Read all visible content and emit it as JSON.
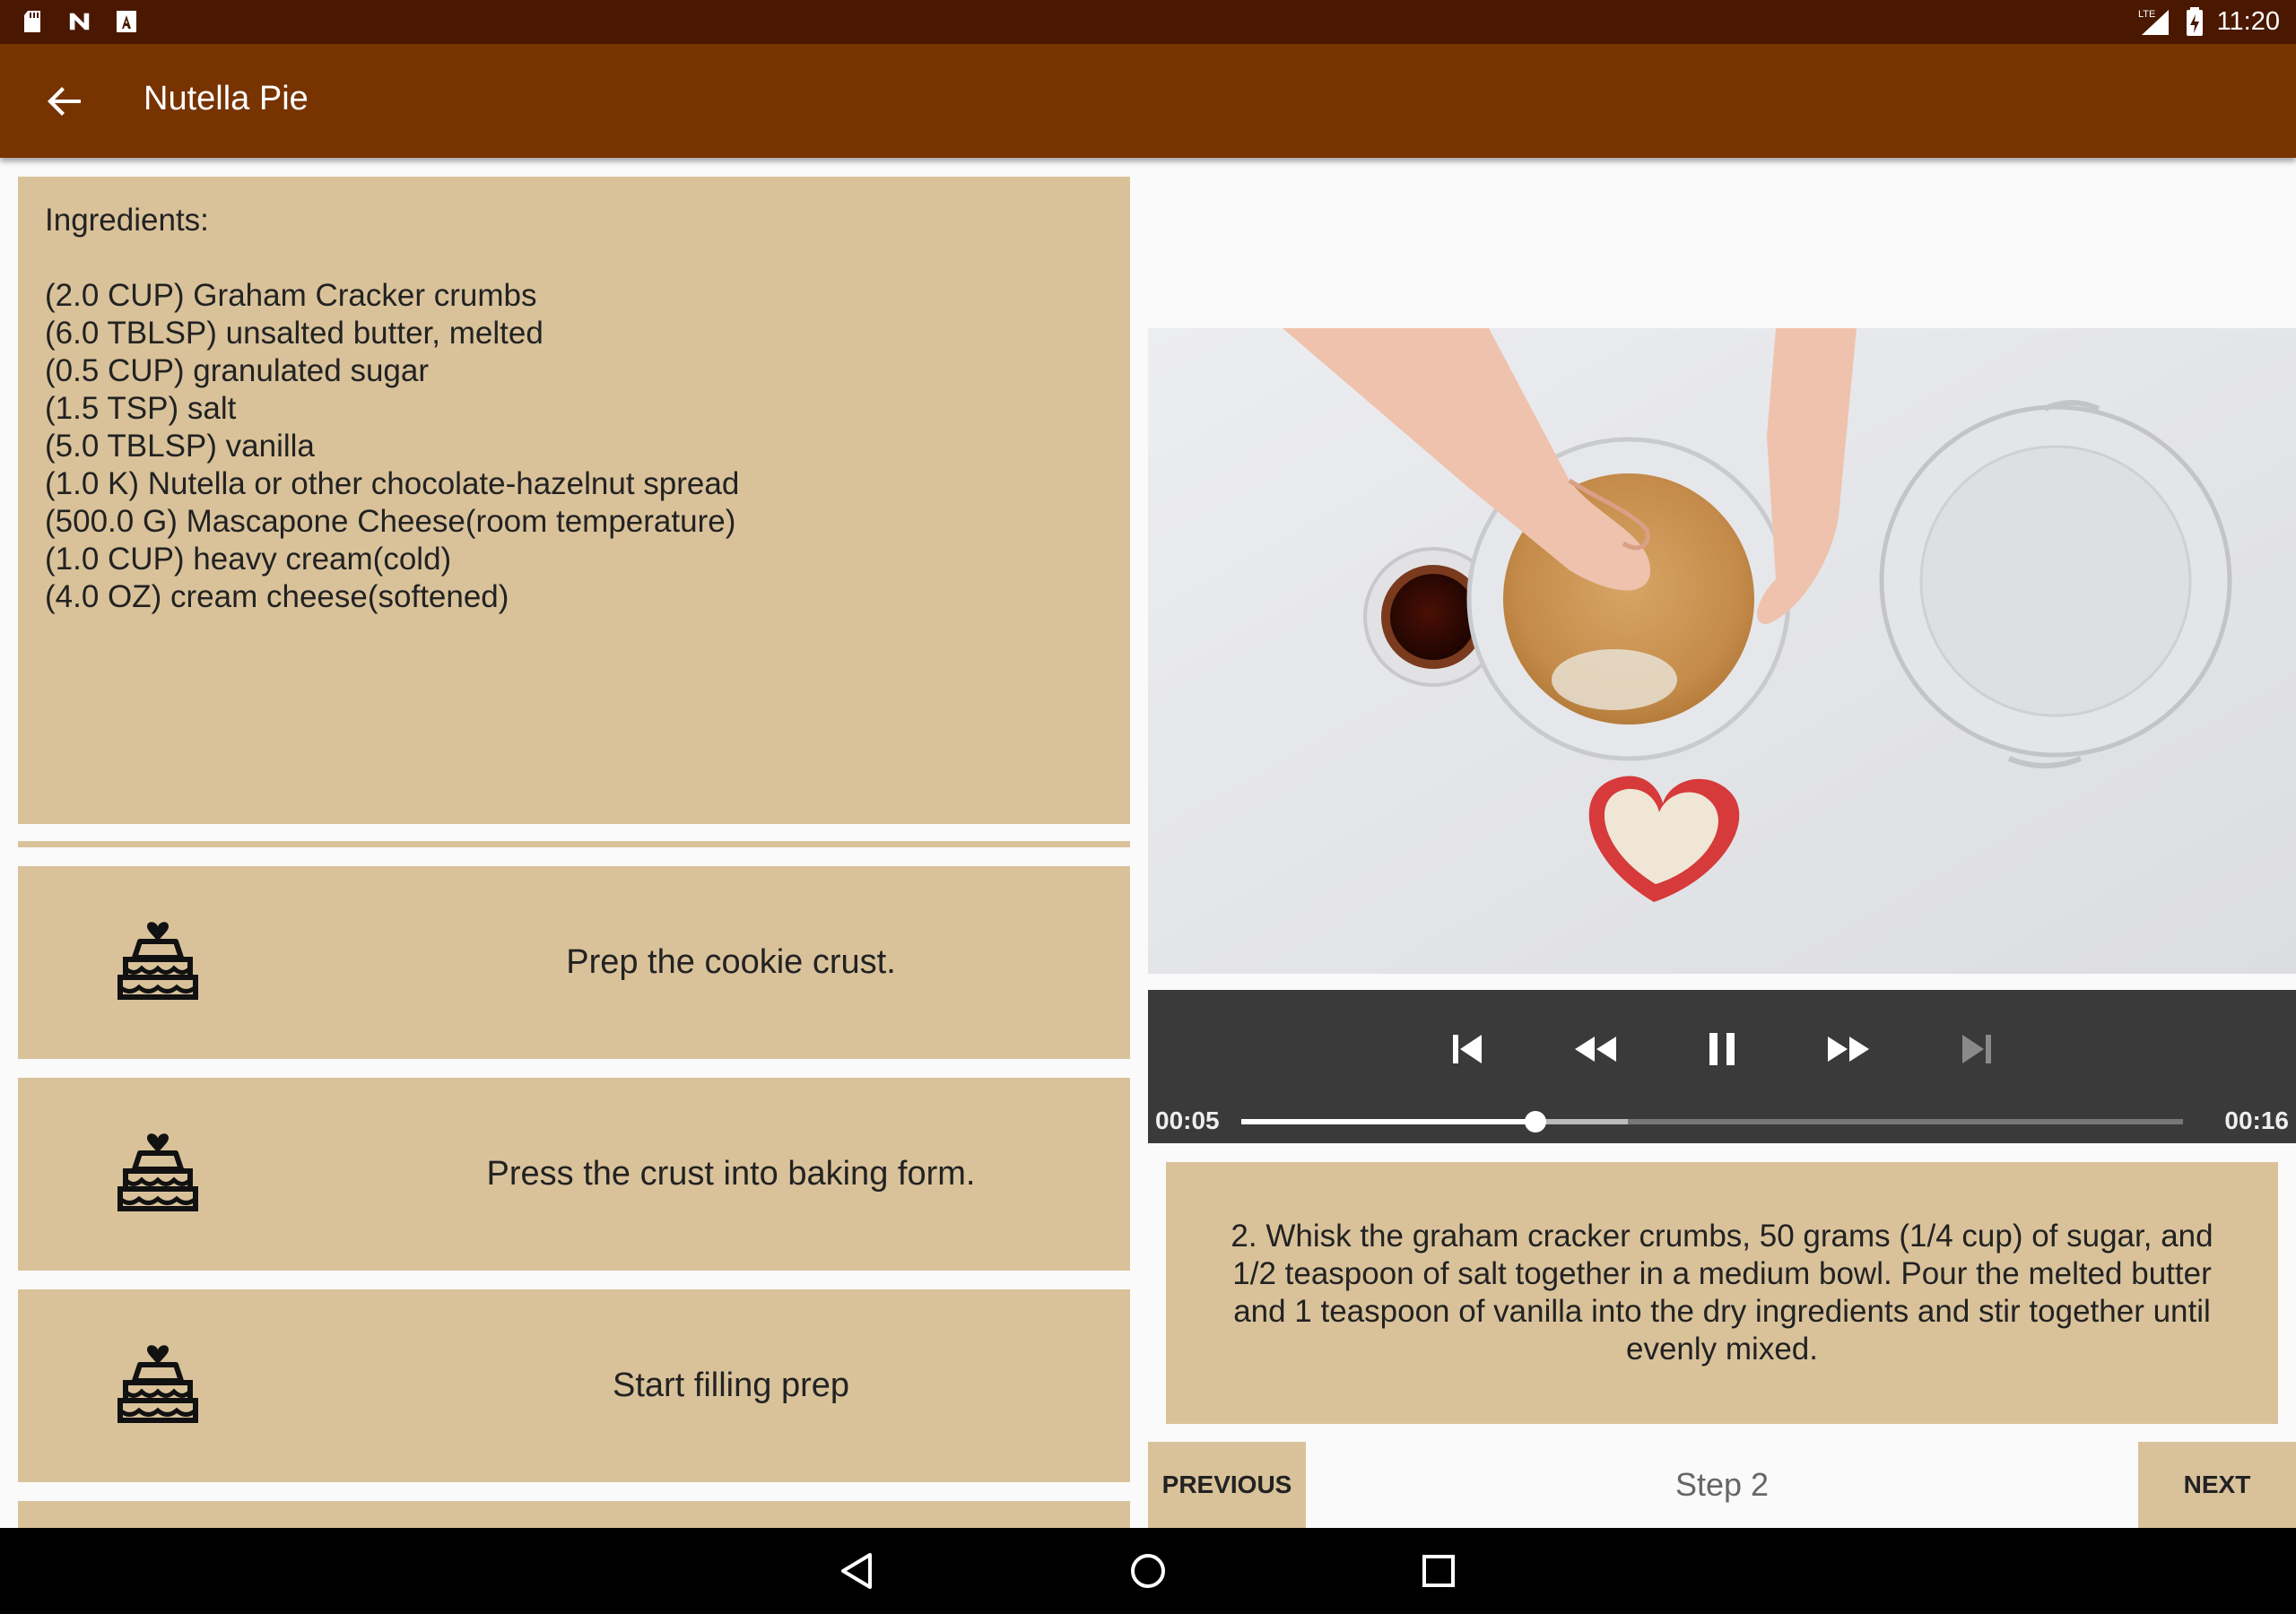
{
  "status_bar": {
    "left_icons": [
      "sd-card-icon",
      "n-logo-icon",
      "a-letter-icon"
    ],
    "network": "LTE",
    "time": "11:20"
  },
  "app_bar": {
    "title": "Nutella Pie",
    "back_icon": "arrow-back-icon"
  },
  "ingredients": {
    "heading": "Ingredients:",
    "items": [
      "(2.0 CUP) Graham Cracker crumbs",
      "(6.0 TBLSP) unsalted butter, melted",
      "(0.5 CUP) granulated sugar",
      "(1.5 TSP) salt",
      "(5.0 TBLSP) vanilla",
      "(1.0 K) Nutella or other chocolate-hazelnut spread",
      "(500.0 G) Mascapone Cheese(room temperature)",
      "(1.0 CUP) heavy cream(cold)",
      "(4.0 OZ) cream cheese(softened)"
    ]
  },
  "steps": [
    {
      "icon": "cake-icon",
      "label": "Prep the cookie crust."
    },
    {
      "icon": "cake-icon",
      "label": "Press the crust into baking form."
    },
    {
      "icon": "cake-icon",
      "label": "Start filling prep"
    }
  ],
  "player": {
    "elapsed": "00:05",
    "duration": "00:16",
    "progress_fraction": 0.3125,
    "buffered_fraction": 0.41,
    "controls": [
      "skip-previous-icon",
      "rewind-icon",
      "pause-icon",
      "fast-forward-icon",
      "skip-next-icon"
    ]
  },
  "step_detail": {
    "description": "2. Whisk the graham cracker crumbs, 50 grams (1/4 cup) of sugar, and 1/2 teaspoon of salt together in a medium bowl. Pour the melted butter and 1 teaspoon of vanilla into the dry ingredients and stir together until evenly mixed."
  },
  "navigation": {
    "previous_label": "PREVIOUS",
    "step_label": "Step 2",
    "next_label": "NEXT"
  },
  "colors": {
    "status_bar": "#4a1800",
    "app_bar": "#773300",
    "card": "#d9c29a",
    "player": "#3a3a3a"
  }
}
